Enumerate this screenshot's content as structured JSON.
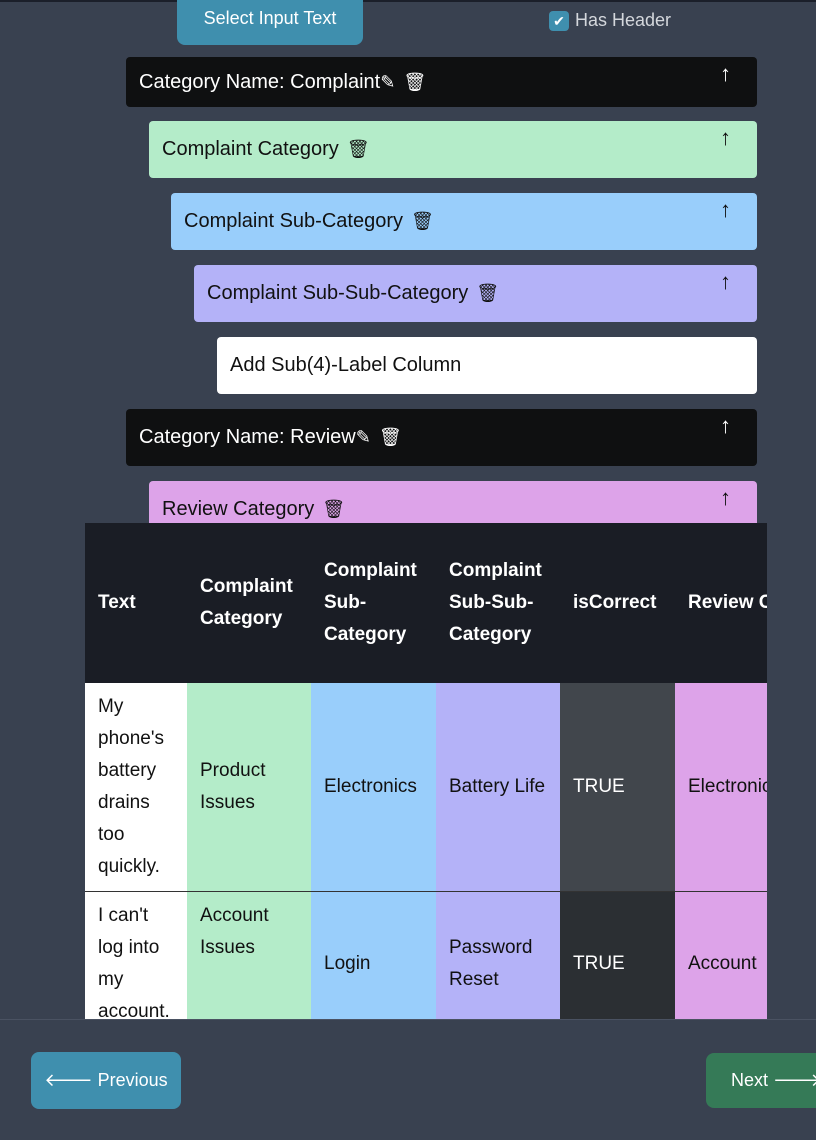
{
  "toolbar": {
    "select_label": "Select Input Text",
    "has_header_label": "Has Header",
    "has_header_checked": true
  },
  "rows": [
    {
      "label": "Category Name: Complaint",
      "kind": "category"
    },
    {
      "label": "Complaint Category",
      "color": "#b4ecc9"
    },
    {
      "label": "Complaint Sub-Category",
      "color": "#99cefb"
    },
    {
      "label": "Complaint Sub-Sub-Category",
      "color": "#b4b2f8"
    },
    {
      "label": "Add Sub(4)-Label Column"
    },
    {
      "label": "Category Name: Review",
      "kind": "category"
    },
    {
      "label": "Review Category",
      "color": "#dda3e9"
    }
  ],
  "icons": {
    "edit": "edit-icon",
    "delete": "trash-icon",
    "up": "arrow-up-icon",
    "up_glyph": "↑"
  },
  "table": {
    "headers": [
      "Text",
      "Complaint Category",
      "Complaint Sub-Category",
      "Complaint Sub-Sub-Category",
      "isCorrect",
      "Review Category"
    ],
    "rows": [
      [
        "My phone's battery drains too quickly.",
        "Product Issues",
        "Electronics",
        "Battery Life",
        "TRUE",
        "Electronics"
      ],
      [
        "I can't log into my account.",
        "Account Issues",
        "Login",
        "Password Reset",
        "TRUE",
        "Account"
      ]
    ]
  },
  "nav": {
    "previous": "Previous",
    "next": "Next"
  }
}
